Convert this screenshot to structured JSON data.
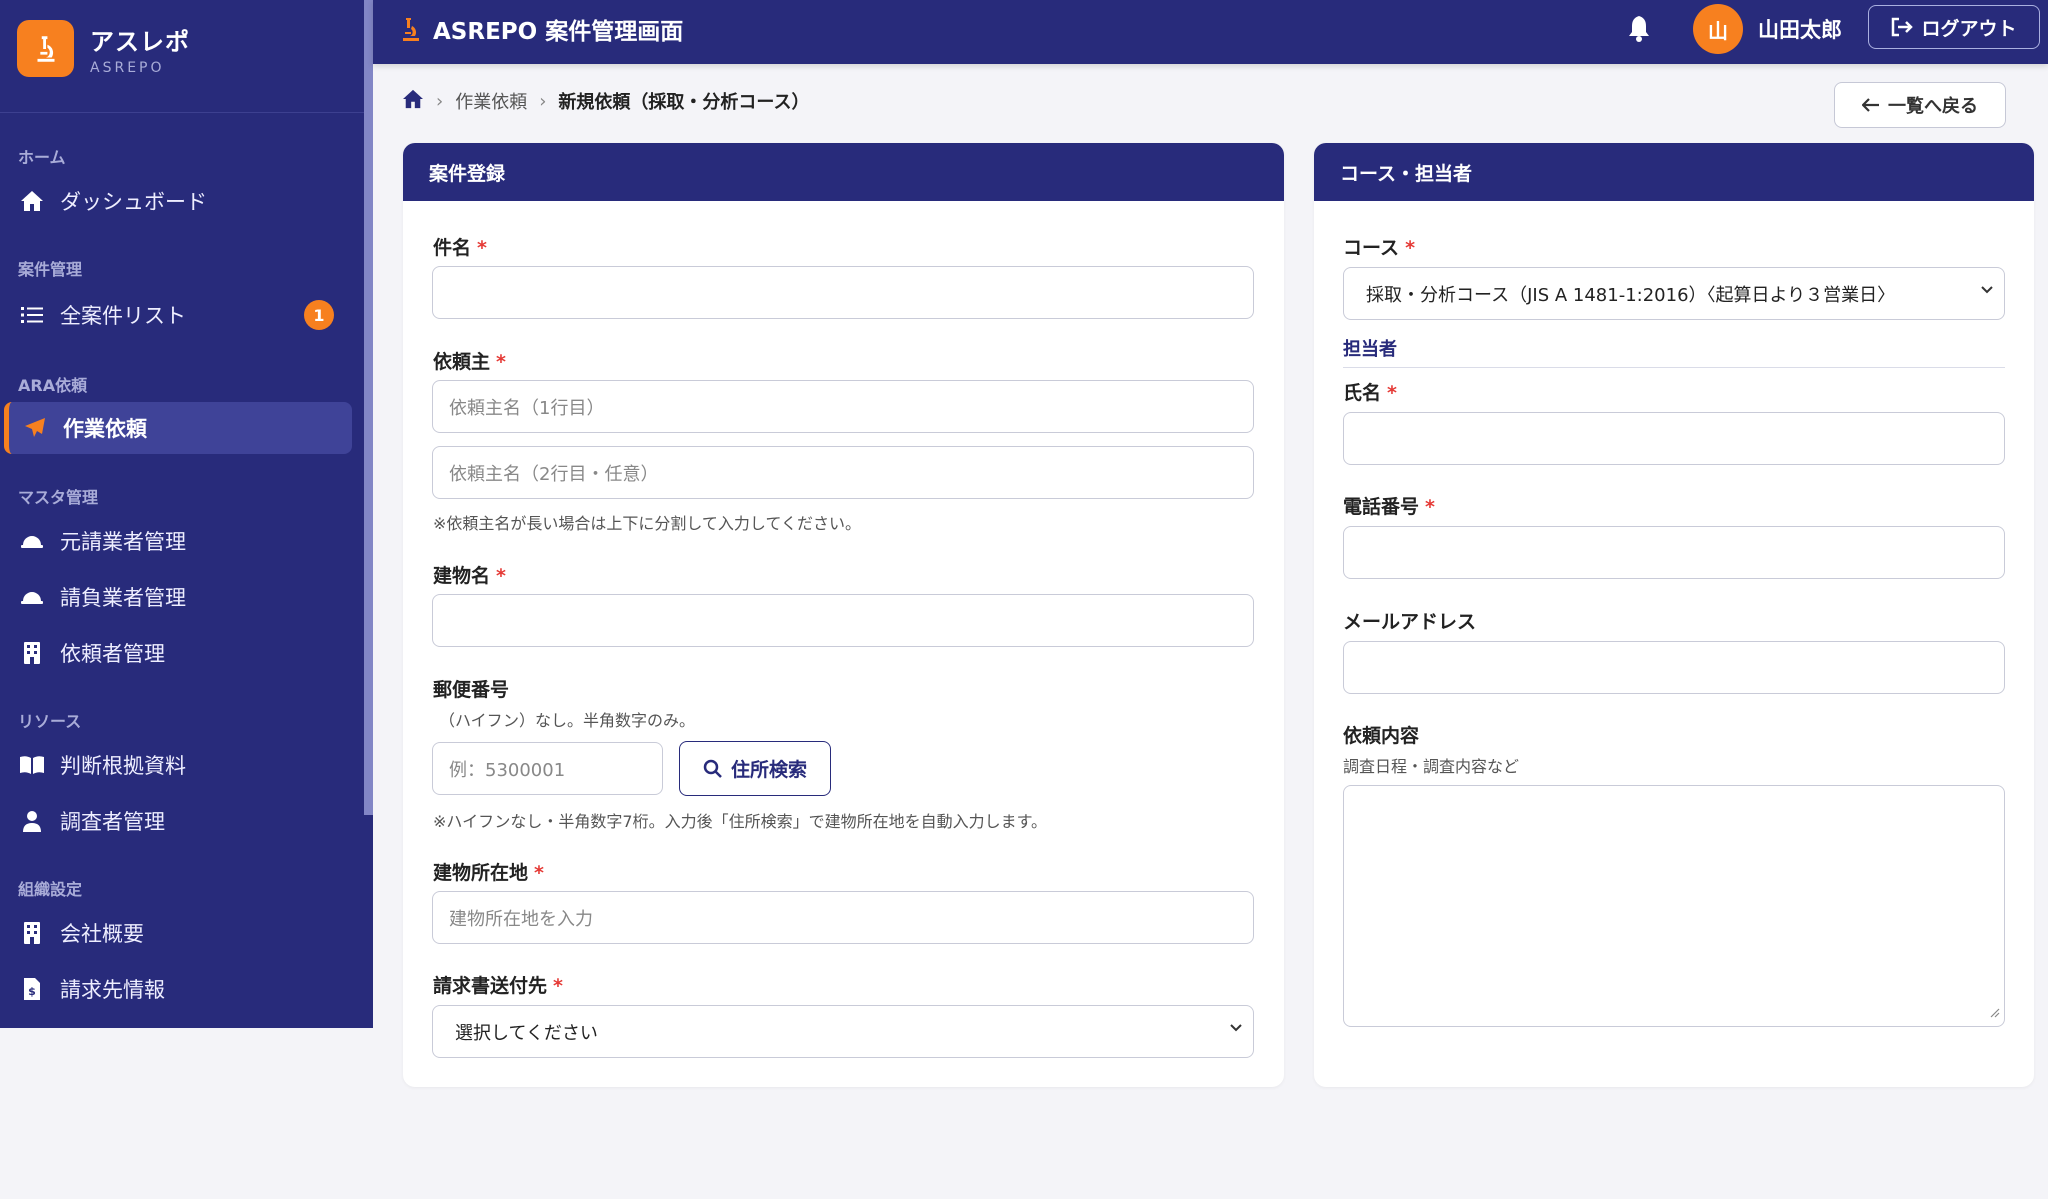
{
  "brand": {
    "name": "アスレポ",
    "sub": "ASREPO"
  },
  "sidebar": {
    "sections": [
      {
        "label": "ホーム"
      },
      {
        "label": "案件管理"
      },
      {
        "label": "ARA依頼"
      },
      {
        "label": "マスタ管理"
      },
      {
        "label": "リソース"
      },
      {
        "label": "組織設定"
      }
    ],
    "items": [
      {
        "label": "ダッシュボード",
        "icon": "home-icon"
      },
      {
        "label": "全案件リスト",
        "icon": "list-icon",
        "badge": "1"
      },
      {
        "label": "作業依頼",
        "icon": "send-icon",
        "active": true
      },
      {
        "label": "元請業者管理",
        "icon": "hardhat-icon"
      },
      {
        "label": "請負業者管理",
        "icon": "hardhat-icon"
      },
      {
        "label": "依頼者管理",
        "icon": "building-icon"
      },
      {
        "label": "判断根拠資料",
        "icon": "book-icon"
      },
      {
        "label": "調査者管理",
        "icon": "user-tie-icon"
      },
      {
        "label": "会社概要",
        "icon": "building-icon"
      },
      {
        "label": "請求先情報",
        "icon": "invoice-icon"
      }
    ]
  },
  "topbar": {
    "title": "ASREPO 案件管理画面",
    "avatar_initial": "山",
    "username": "山田太郎",
    "logout_label": "ログアウト"
  },
  "breadcrumb": {
    "items": [
      "作業依頼",
      "新規依頼（採取・分析コース）"
    ]
  },
  "back_button": "一覧へ戻る",
  "left_card": {
    "title": "案件登録",
    "subject": {
      "label": "件名",
      "required": "*",
      "value": ""
    },
    "client": {
      "label": "依頼主",
      "required": "*",
      "placeholder1": "依頼主名（1行目）",
      "placeholder2": "依頼主名（2行目・任意）",
      "hint": "※依頼主名が長い場合は上下に分割して入力してください。"
    },
    "building": {
      "label": "建物名",
      "required": "*",
      "value": ""
    },
    "postal": {
      "label": "郵便番号",
      "sublabel": "（ハイフン）なし。半角数字のみ。",
      "placeholder": "例：5300001",
      "search_button": "住所検索",
      "hint": "※ハイフンなし・半角数字7桁。入力後「住所検索」で建物所在地を自動入力します。"
    },
    "address": {
      "label": "建物所在地",
      "required": "*",
      "placeholder": "建物所在地を入力"
    },
    "billing": {
      "label": "請求書送付先",
      "required": "*",
      "selected": "選択してください"
    }
  },
  "right_card": {
    "title": "コース・担当者",
    "course": {
      "label": "コース",
      "required": "*",
      "selected": "採取・分析コース（JIS A 1481-1:2016）〈起算日より３営業日〉"
    },
    "person_heading": "担当者",
    "name": {
      "label": "氏名",
      "required": "*",
      "value": ""
    },
    "phone": {
      "label": "電話番号",
      "required": "*",
      "value": ""
    },
    "email": {
      "label": "メールアドレス",
      "value": ""
    },
    "request": {
      "label": "依頼内容",
      "sublabel": "調査日程・調査内容など",
      "value": ""
    }
  },
  "colors": {
    "primary": "#282b7b",
    "accent": "#f7801f",
    "required": "#e53935"
  }
}
